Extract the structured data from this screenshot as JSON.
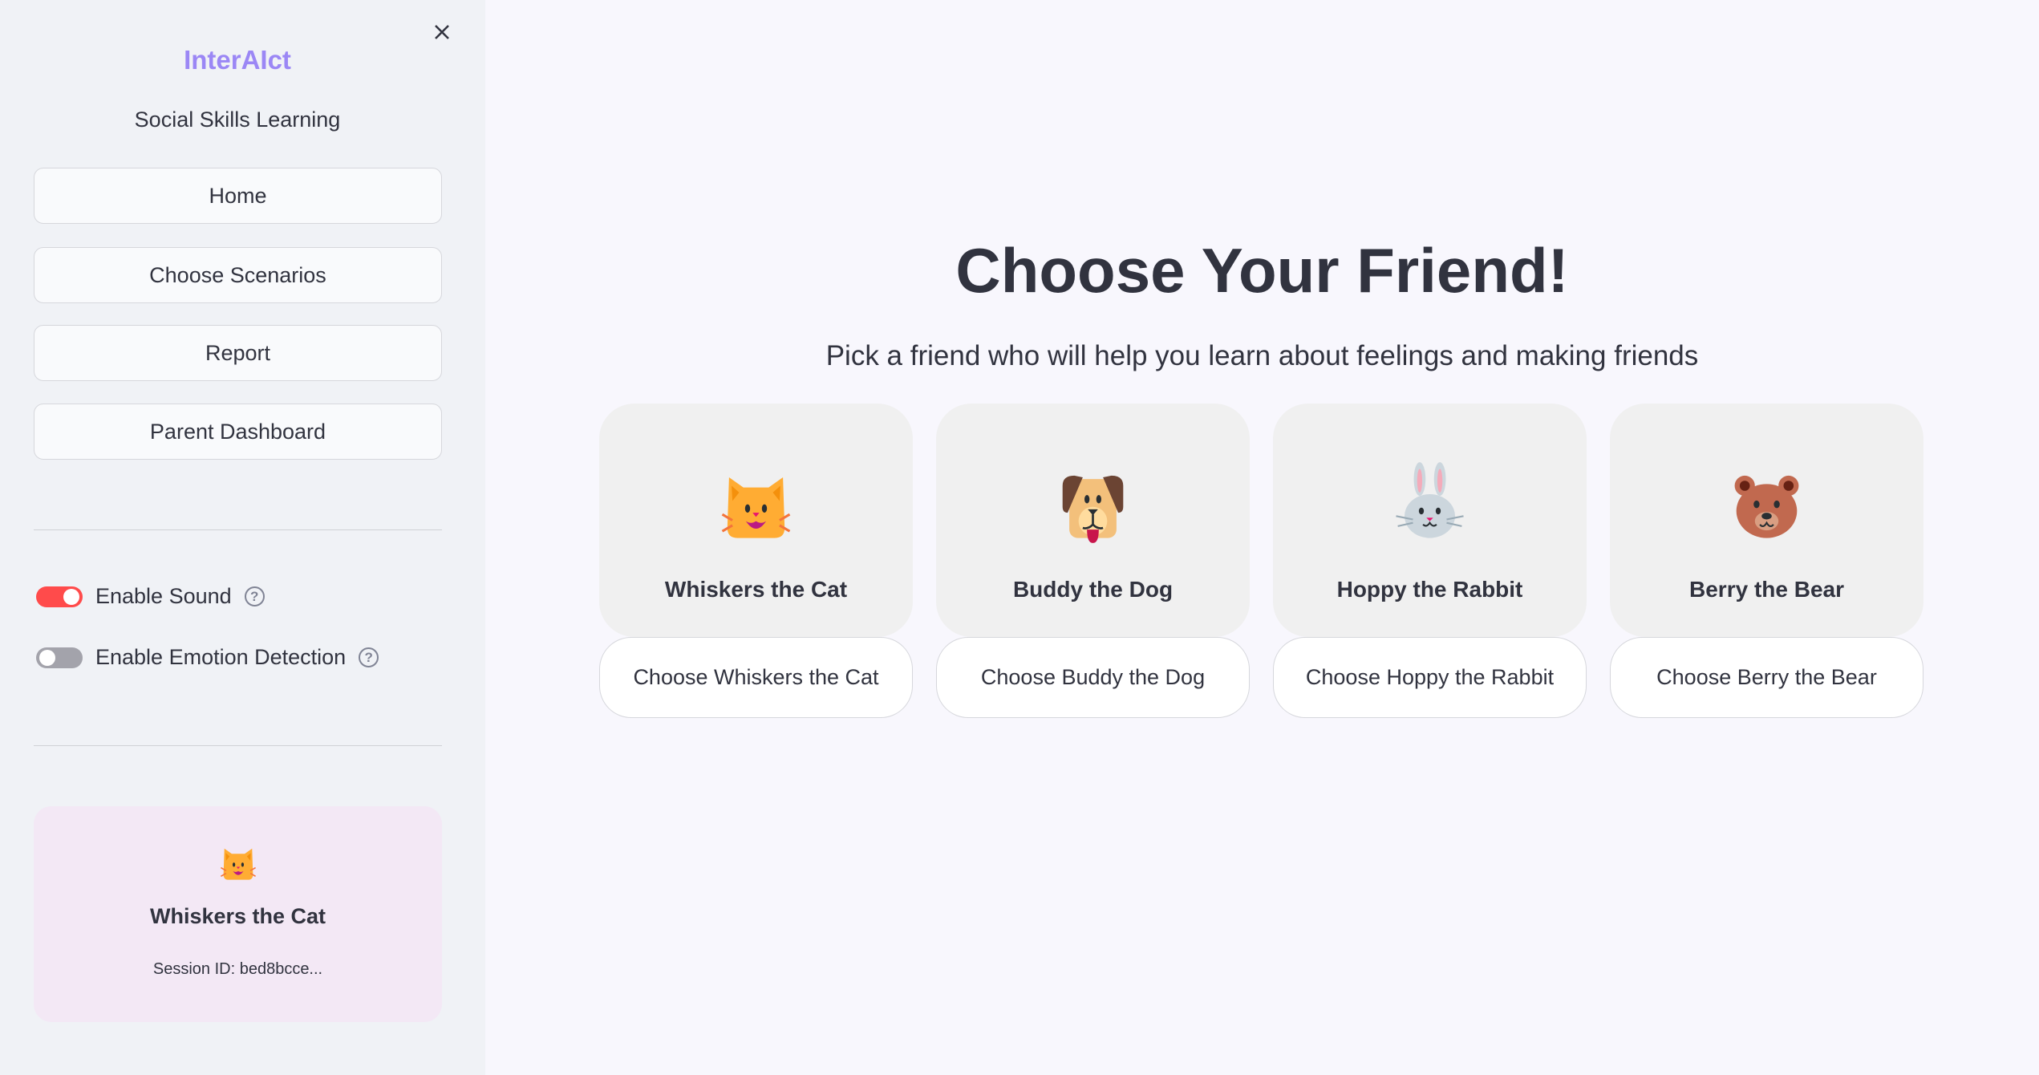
{
  "sidebar": {
    "brand": "InterAIct",
    "tagline": "Social Skills Learning",
    "nav": [
      {
        "label": "Home"
      },
      {
        "label": "Choose Scenarios"
      },
      {
        "label": "Report"
      },
      {
        "label": "Parent Dashboard"
      }
    ],
    "toggles": [
      {
        "label": "Enable Sound",
        "on": true
      },
      {
        "label": "Enable Emotion Detection",
        "on": false
      }
    ],
    "current_friend": {
      "icon": "cat-face-icon",
      "name": "Whiskers the Cat",
      "session": "Session ID: bed8bcce..."
    }
  },
  "main": {
    "title": "Choose Your Friend!",
    "subtitle": "Pick a friend who will help you learn about feelings and making friends",
    "friends": [
      {
        "name": "Whiskers the Cat",
        "icon": "cat-face-icon",
        "button": "Choose Whiskers the Cat"
      },
      {
        "name": "Buddy the Dog",
        "icon": "dog-face-icon",
        "button": "Choose Buddy the Dog"
      },
      {
        "name": "Hoppy the Rabbit",
        "icon": "rabbit-face-icon",
        "button": "Choose Hoppy the Rabbit"
      },
      {
        "name": "Berry the Bear",
        "icon": "bear-face-icon",
        "button": "Choose Berry the Bear"
      }
    ]
  },
  "colors": {
    "accent": "#9b87f5",
    "toggle_on": "#ff4b4b",
    "toggle_off": "#a3a3ab"
  }
}
